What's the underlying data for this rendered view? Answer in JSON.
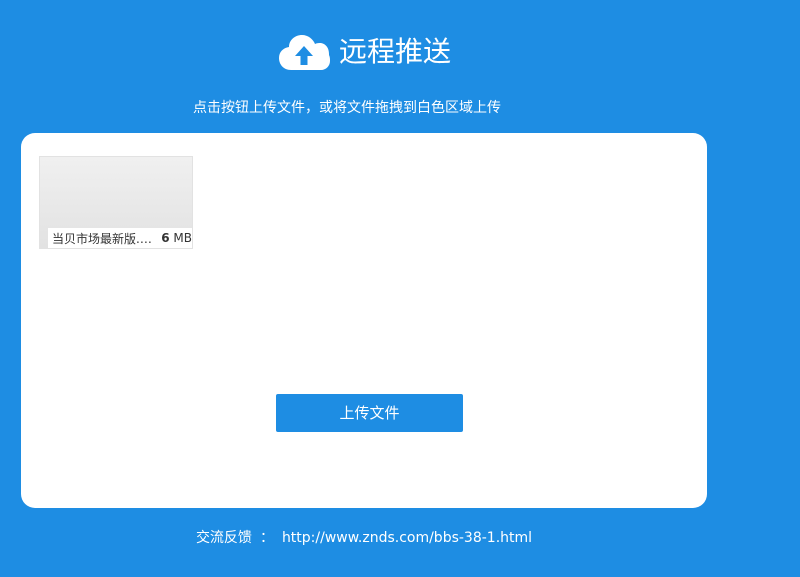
{
  "header": {
    "title": "远程推送",
    "icon": "cloud-upload-icon"
  },
  "instruction": "点击按钮上传文件，或将文件拖拽到白色区域上传",
  "file": {
    "name": "当贝市场最新版.a...",
    "size_value": "6",
    "size_unit": "MB"
  },
  "upload_button_label": "上传文件",
  "footer": {
    "label": "交流反馈",
    "separator": "：",
    "link": "http://www.znds.com/bbs-38-1.html"
  },
  "colors": {
    "background": "#1e8de3",
    "panel": "#ffffff",
    "button": "#1e8de3"
  }
}
